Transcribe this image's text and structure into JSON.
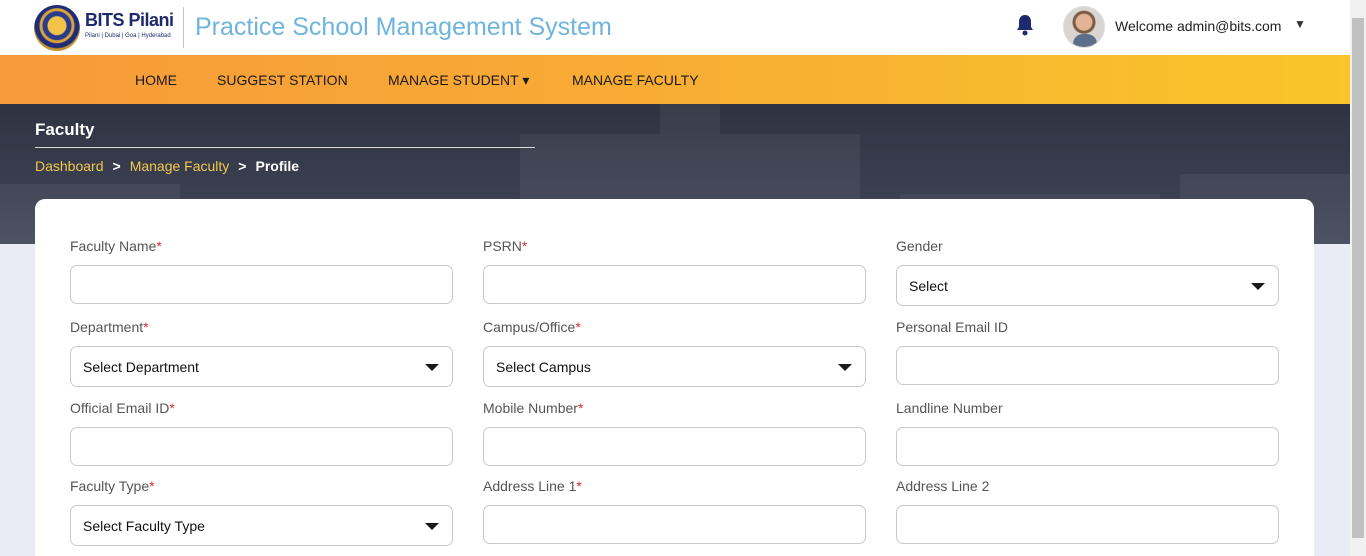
{
  "header": {
    "logo_name": "BITS Pilani",
    "logo_sub": "Pilani | Dubai | Goa | Hyderabad",
    "app_title": "Practice School Management System",
    "welcome": "Welcome admin@bits.com",
    "caret": "▼"
  },
  "nav": {
    "items": [
      {
        "label": "HOME"
      },
      {
        "label": "SUGGEST STATION"
      },
      {
        "label": "MANAGE STUDENT ▾"
      },
      {
        "label": "MANAGE FACULTY"
      }
    ]
  },
  "banner": {
    "title": "Faculty",
    "breadcrumb": {
      "items": [
        "Dashboard",
        "Manage Faculty"
      ],
      "separator": ">",
      "current": "Profile"
    }
  },
  "form": {
    "faculty_name": {
      "label": "Faculty Name",
      "required": "*",
      "value": ""
    },
    "psrn": {
      "label": "PSRN",
      "required": "*",
      "value": ""
    },
    "gender": {
      "label": "Gender",
      "selected": "Select"
    },
    "department": {
      "label": "Department",
      "required": "*",
      "selected": "Select Department"
    },
    "campus": {
      "label": "Campus/Office",
      "required": "*",
      "selected": "Select Campus"
    },
    "personal_email": {
      "label": "Personal Email ID",
      "value": ""
    },
    "official_email": {
      "label": "Official Email ID",
      "required": "*",
      "value": ""
    },
    "mobile": {
      "label": "Mobile Number",
      "required": "*",
      "value": ""
    },
    "landline": {
      "label": "Landline Number",
      "value": ""
    },
    "faculty_type": {
      "label": "Faculty Type",
      "required": "*",
      "selected": "Select Faculty Type"
    },
    "address1": {
      "label": "Address Line 1",
      "required": "*",
      "value": ""
    },
    "address2": {
      "label": "Address Line 2",
      "value": ""
    }
  },
  "colors": {
    "nav_start": "#f79a3a",
    "nav_end": "#f9c529",
    "title_blue": "#6fb4dd",
    "bell": "#1d2a6e",
    "breadcrumb_link": "#f2c84b",
    "required": "#d32f2f"
  },
  "icons": {
    "bell": "bell-icon",
    "dropdown": "chevron-down-icon"
  }
}
